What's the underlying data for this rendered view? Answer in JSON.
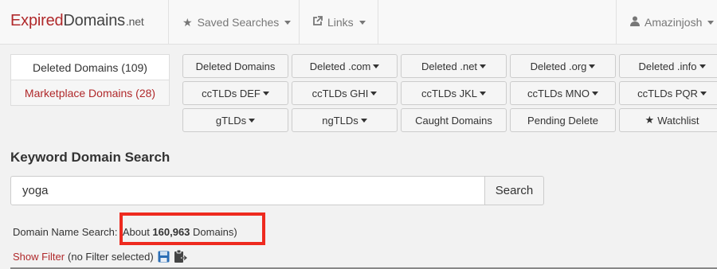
{
  "navbar": {
    "brand": {
      "part1": "Expired",
      "part2": "Domains",
      "part3": ".net"
    },
    "saved_searches": {
      "icon": "star-icon",
      "label": "Saved Searches"
    },
    "links": {
      "icon": "external-link-icon",
      "label": "Links"
    },
    "user": {
      "icon": "user-icon",
      "label": "Amazinjosh"
    }
  },
  "side_tabs": {
    "deleted": "Deleted Domains (109)",
    "marketplace": "Marketplace Domains (28)"
  },
  "buttons": {
    "row1": [
      "Deleted Domains",
      "Deleted .com",
      "Deleted .net",
      "Deleted .org",
      "Deleted .info"
    ],
    "row2": [
      "ccTLDs DEF",
      "ccTLDs GHI",
      "ccTLDs JKL",
      "ccTLDs MNO",
      "ccTLDs PQR"
    ],
    "row3": [
      "gTLDs",
      "ngTLDs",
      "Caught Domains",
      "Pending Delete",
      "Watchlist"
    ],
    "watchlist_icon": "star-icon"
  },
  "search": {
    "title": "Keyword Domain Search",
    "value": "yoga",
    "button": "Search"
  },
  "results": {
    "label": "Domain Name Search:",
    "about_prefix": "(About ",
    "count": "160,963",
    "about_suffix": " Domains)",
    "highlight_color": "#ee2a1f"
  },
  "filter": {
    "link": "Show Filter",
    "status": "(no Filter selected)",
    "save_icon": "floppy-disk-icon",
    "clipboard_icon": "clipboard-arrow-icon"
  },
  "colors": {
    "brand_red": "#b0292b",
    "brand_gray": "#444444"
  }
}
